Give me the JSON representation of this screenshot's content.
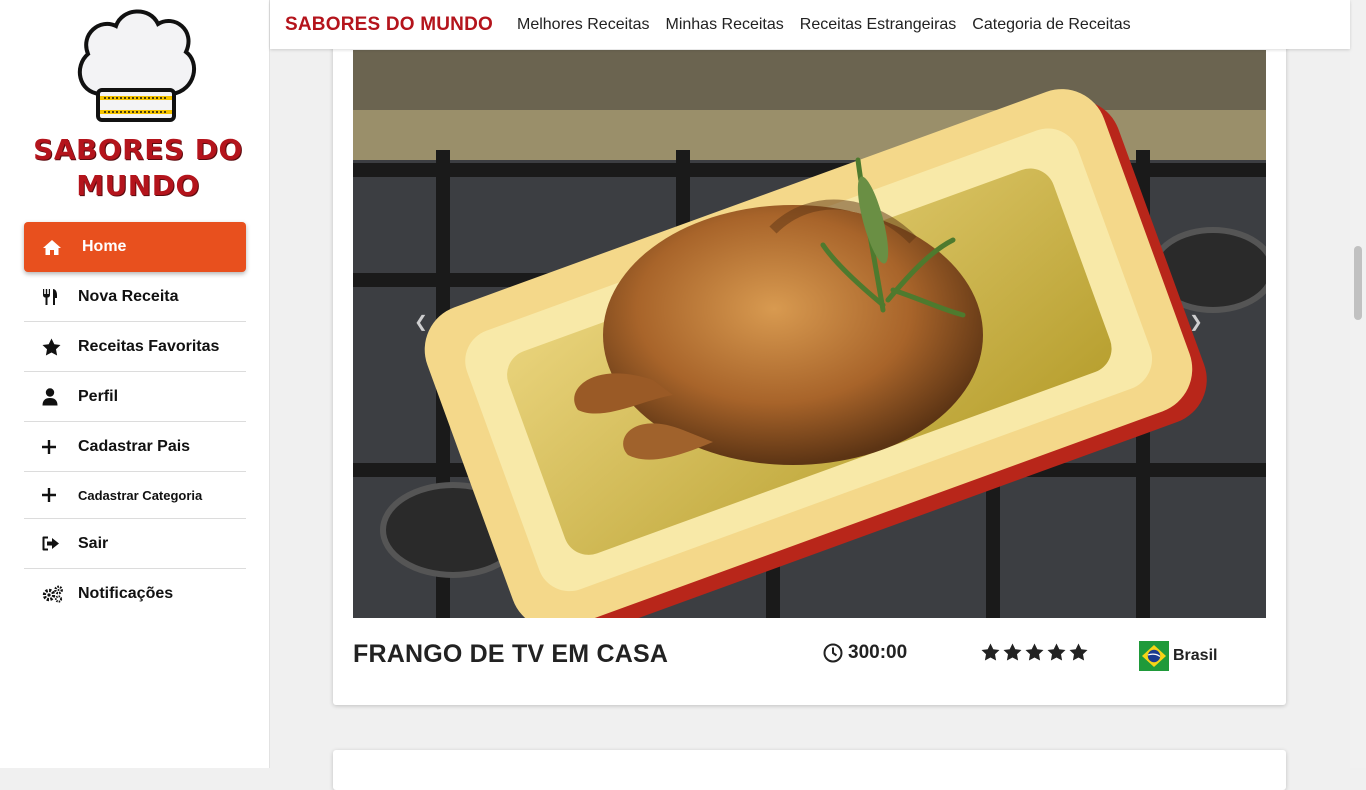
{
  "sidebar": {
    "logo_text": "SABORES DO MUNDO",
    "items": [
      {
        "label": "Home",
        "icon": "home-icon",
        "active": true
      },
      {
        "label": "Nova Receita",
        "icon": "utensils-icon"
      },
      {
        "label": "Receitas Favoritas",
        "icon": "star-icon"
      },
      {
        "label": "Perfil",
        "icon": "user-icon"
      },
      {
        "label": "Cadastrar Pais",
        "icon": "plus-icon"
      },
      {
        "label": "Cadastrar Categoria",
        "icon": "plus-icon"
      },
      {
        "label": "Sair",
        "icon": "sign-out-icon"
      },
      {
        "label": "Notificações",
        "icon": "gears-icon"
      }
    ]
  },
  "navbar": {
    "brand": "SABORES DO MUNDO",
    "links": [
      "Melhores Receitas",
      "Minhas Receitas",
      "Receitas Estrangeiras",
      "Categoria de Receitas"
    ]
  },
  "recipe": {
    "title": "FRANGO DE TV EM CASA",
    "time": "300:00",
    "rating": 5,
    "country": "Brasil"
  },
  "colors": {
    "accent": "#e8501e",
    "brand": "#b4141c"
  }
}
